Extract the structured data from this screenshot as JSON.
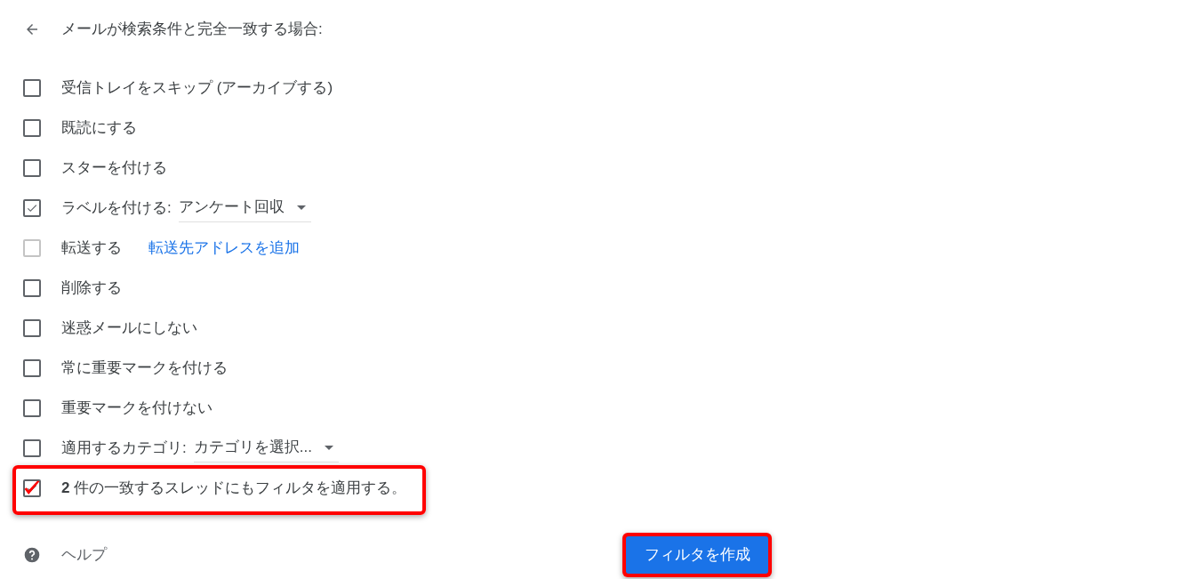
{
  "header": {
    "title": "メールが検索条件と完全一致する場合:"
  },
  "options": [
    {
      "kind": "plain",
      "label": "受信トレイをスキップ (アーカイブする)",
      "checked": false,
      "disabled": false,
      "highlighted": false
    },
    {
      "kind": "plain",
      "label": "既読にする",
      "checked": false,
      "disabled": false,
      "highlighted": false
    },
    {
      "kind": "plain",
      "label": "スターを付ける",
      "checked": false,
      "disabled": false,
      "highlighted": false
    },
    {
      "kind": "select",
      "label": "ラベルを付ける:",
      "value": "アンケート回収",
      "checked": true,
      "disabled": false,
      "highlighted": false
    },
    {
      "kind": "link",
      "label": "転送する",
      "link": "転送先アドレスを追加",
      "checked": false,
      "disabled": true,
      "highlighted": false
    },
    {
      "kind": "plain",
      "label": "削除する",
      "checked": false,
      "disabled": false,
      "highlighted": false
    },
    {
      "kind": "plain",
      "label": "迷惑メールにしない",
      "checked": false,
      "disabled": false,
      "highlighted": false
    },
    {
      "kind": "plain",
      "label": "常に重要マークを付ける",
      "checked": false,
      "disabled": false,
      "highlighted": false
    },
    {
      "kind": "plain",
      "label": "重要マークを付けない",
      "checked": false,
      "disabled": false,
      "highlighted": false
    },
    {
      "kind": "select",
      "label": "適用するカテゴリ:",
      "value": "カテゴリを選択...",
      "checked": false,
      "disabled": false,
      "highlighted": false
    },
    {
      "kind": "plain",
      "label": "**2** 件の一致するスレッドにもフィルタを適用する。",
      "checked": true,
      "disabled": false,
      "highlighted": true
    }
  ],
  "footer": {
    "help": "ヘルプ",
    "create_button": {
      "label": "フィルタを作成",
      "highlighted": true
    }
  }
}
